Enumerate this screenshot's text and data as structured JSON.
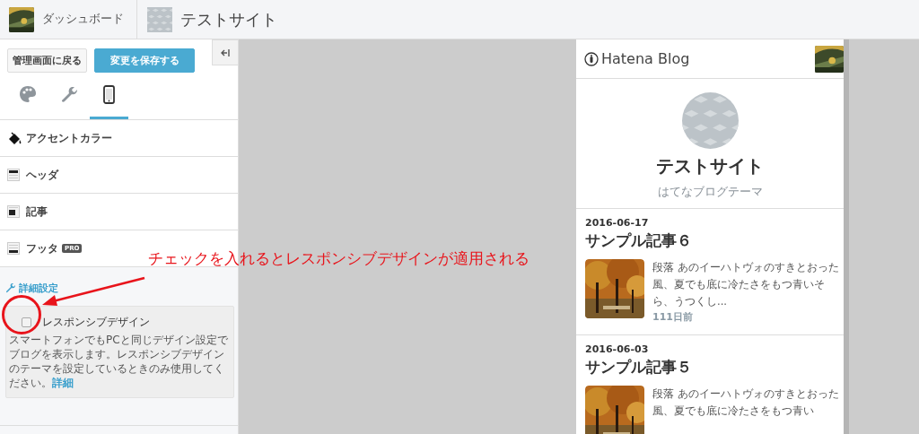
{
  "top_bar": {
    "dashboard_link": "ダッシュボード",
    "site_title": "テストサイト"
  },
  "sidebar": {
    "back_button": "管理画面に戻る",
    "save_button": "変更を保存する",
    "tabs": [
      {
        "kind": "palette",
        "selected": false
      },
      {
        "kind": "wrench",
        "selected": false
      },
      {
        "kind": "phone",
        "selected": true
      }
    ],
    "sections": [
      {
        "kind": "accent",
        "label": "アクセントカラー"
      },
      {
        "kind": "header",
        "label": "ヘッダ"
      },
      {
        "kind": "article",
        "label": "記事"
      },
      {
        "kind": "footer",
        "label": "フッタ",
        "badge": "PRO"
      }
    ],
    "advanced": {
      "title": "詳細設定",
      "option": {
        "label": "レスポンシブデザイン",
        "checked": false
      },
      "description": "スマートフォンでもPCと同じデザイン設定でブログを表示します。レスポンシブデザインのテーマを設定しているときのみ使用してください。",
      "link": "詳細"
    }
  },
  "annotation": {
    "text": "チェックを入れるとレスポンシブデザインが適用される"
  },
  "preview": {
    "brand": "Hatena Blog",
    "blog_title": "テストサイト",
    "blog_subtitle": "はてなブログテーマ",
    "entries": [
      {
        "date": "2016-06-17",
        "title": "サンプル記事６",
        "excerpt": "段落 あのイーハトヴォのすきとおった風、夏でも底に冷たさをもつ青いそら、うつくし...",
        "age": "111日前"
      },
      {
        "date": "2016-06-03",
        "title": "サンプル記事５",
        "excerpt": "段落 あのイーハトヴォのすきとおった風、夏でも底に冷たさをもつ青い"
      }
    ]
  }
}
